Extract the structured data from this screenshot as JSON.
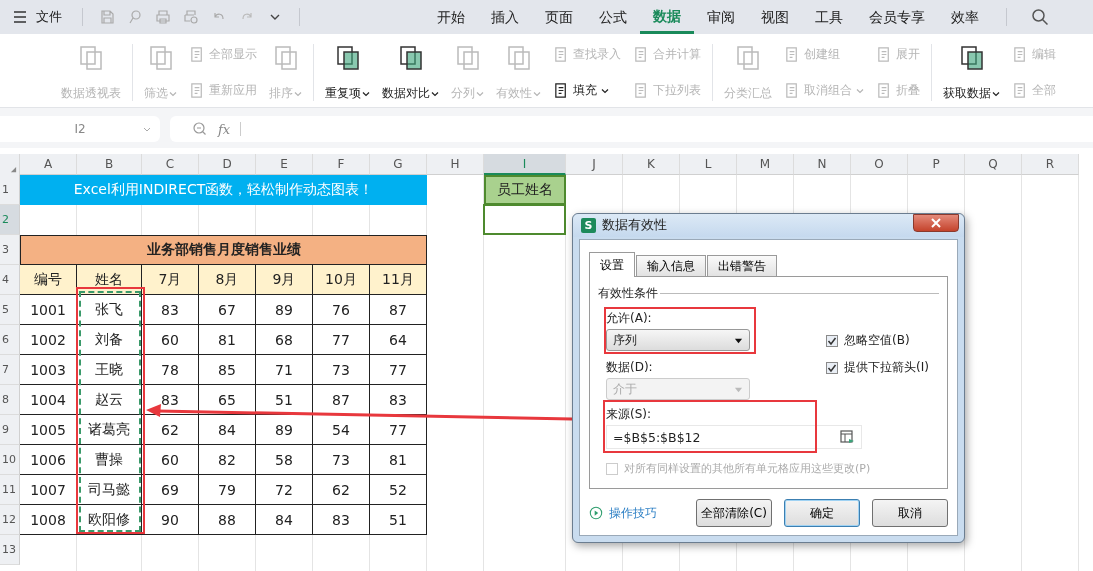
{
  "title_bar": {
    "file_menu": "文件",
    "tabs": [
      {
        "label": "开始",
        "selected": false
      },
      {
        "label": "插入",
        "selected": false
      },
      {
        "label": "页面",
        "selected": false
      },
      {
        "label": "公式",
        "selected": false
      },
      {
        "label": "数据",
        "selected": true
      },
      {
        "label": "审阅",
        "selected": false
      },
      {
        "label": "视图",
        "selected": false
      },
      {
        "label": "工具",
        "selected": false
      },
      {
        "label": "会员专享",
        "selected": false
      },
      {
        "label": "效率",
        "selected": false
      }
    ]
  },
  "ribbon": {
    "groups": [
      {
        "columns": [
          {
            "kind": "large",
            "label": "数据透视表",
            "disabled": true,
            "dropdown": false
          }
        ]
      },
      {
        "columns": [
          {
            "kind": "large",
            "label": "筛选",
            "disabled": true,
            "dropdown": true
          },
          {
            "kind": "stack",
            "items": [
              {
                "label": "全部显示",
                "disabled": true,
                "dropdown": false
              },
              {
                "label": "重新应用",
                "disabled": true,
                "dropdown": false
              }
            ]
          },
          {
            "kind": "large",
            "label": "排序",
            "disabled": true,
            "dropdown": true
          }
        ]
      },
      {
        "columns": [
          {
            "kind": "large",
            "label": "重复项",
            "disabled": false,
            "dropdown": true
          },
          {
            "kind": "large",
            "label": "数据对比",
            "disabled": false,
            "dropdown": true
          },
          {
            "kind": "large",
            "label": "分列",
            "disabled": true,
            "dropdown": true
          },
          {
            "kind": "large",
            "label": "有效性",
            "disabled": true,
            "dropdown": true
          },
          {
            "kind": "stack",
            "items": [
              {
                "label": "查找录入",
                "disabled": true,
                "dropdown": false
              },
              {
                "label": "填充",
                "disabled": false,
                "dropdown": true
              }
            ]
          },
          {
            "kind": "stack",
            "items": [
              {
                "label": "合并计算",
                "disabled": true,
                "dropdown": false
              },
              {
                "label": "下拉列表",
                "disabled": true,
                "dropdown": false
              }
            ]
          }
        ]
      },
      {
        "columns": [
          {
            "kind": "large",
            "label": "分类汇总",
            "disabled": true,
            "dropdown": false
          },
          {
            "kind": "stack",
            "items": [
              {
                "label": "创建组",
                "disabled": true,
                "dropdown": false
              },
              {
                "label": "取消组合",
                "disabled": true,
                "dropdown": true
              }
            ]
          },
          {
            "kind": "stack",
            "items": [
              {
                "label": "展开",
                "disabled": true,
                "dropdown": false
              },
              {
                "label": "折叠",
                "disabled": true,
                "dropdown": false
              }
            ]
          }
        ]
      },
      {
        "columns": [
          {
            "kind": "large",
            "label": "获取数据",
            "disabled": false,
            "dropdown": true
          },
          {
            "kind": "stack",
            "items": [
              {
                "label": "编辑",
                "disabled": true,
                "dropdown": false
              },
              {
                "label": "全部",
                "disabled": true,
                "dropdown": false
              }
            ]
          }
        ]
      }
    ]
  },
  "formula_bar": {
    "cell_reference": "I2",
    "function_label": "fx"
  },
  "sheet": {
    "columns": [
      {
        "label": "A",
        "selected": false
      },
      {
        "label": "B",
        "selected": false
      },
      {
        "label": "C",
        "selected": false
      },
      {
        "label": "D",
        "selected": false
      },
      {
        "label": "E",
        "selected": false
      },
      {
        "label": "F",
        "selected": false
      },
      {
        "label": "G",
        "selected": false
      },
      {
        "label": "H",
        "selected": false
      },
      {
        "label": "I",
        "selected": true
      },
      {
        "label": "J",
        "selected": false
      },
      {
        "label": "K",
        "selected": false
      },
      {
        "label": "L",
        "selected": false
      },
      {
        "label": "M",
        "selected": false
      },
      {
        "label": "N",
        "selected": false
      },
      {
        "label": "O",
        "selected": false
      },
      {
        "label": "P",
        "selected": false
      },
      {
        "label": "Q",
        "selected": false
      },
      {
        "label": "R",
        "selected": false
      }
    ],
    "row_numbers": [
      {
        "label": "1",
        "selected": false
      },
      {
        "label": "2",
        "selected": true
      },
      {
        "label": "3",
        "selected": false
      },
      {
        "label": "4",
        "selected": false
      },
      {
        "label": "5",
        "selected": false
      },
      {
        "label": "6",
        "selected": false
      },
      {
        "label": "7",
        "selected": false
      },
      {
        "label": "8",
        "selected": false
      },
      {
        "label": "9",
        "selected": false
      },
      {
        "label": "10",
        "selected": false
      },
      {
        "label": "11",
        "selected": false
      },
      {
        "label": "12",
        "selected": false
      },
      {
        "label": "13",
        "selected": false
      }
    ],
    "banner": "Excel利用INDIRECT函数，轻松制作动态图表！",
    "lookup_label": "员工姓名",
    "table": {
      "caption": "业务部销售月度销售业绩",
      "headers": [
        "编号",
        "姓名",
        "7月",
        "8月",
        "9月",
        "10月",
        "11月"
      ],
      "rows": [
        [
          "1001",
          "张飞",
          "83",
          "67",
          "89",
          "76",
          "87"
        ],
        [
          "1002",
          "刘备",
          "60",
          "81",
          "68",
          "77",
          "64"
        ],
        [
          "1003",
          "王晓",
          "78",
          "85",
          "71",
          "73",
          "77"
        ],
        [
          "1004",
          "赵云",
          "83",
          "65",
          "51",
          "87",
          "83"
        ],
        [
          "1005",
          "诸葛亮",
          "62",
          "84",
          "89",
          "54",
          "77"
        ],
        [
          "1006",
          "曹操",
          "60",
          "82",
          "58",
          "73",
          "81"
        ],
        [
          "1007",
          "司马懿",
          "69",
          "79",
          "72",
          "62",
          "52"
        ],
        [
          "1008",
          "欧阳修",
          "90",
          "88",
          "84",
          "83",
          "51"
        ]
      ]
    }
  },
  "dialog": {
    "app_badge": "S",
    "title": "数据有效性",
    "tabs": [
      {
        "label": "设置",
        "selected": true
      },
      {
        "label": "输入信息",
        "selected": false
      },
      {
        "label": "出错警告",
        "selected": false
      }
    ],
    "section": "有效性条件",
    "allow_label": "允许(A):",
    "allow_value": "序列",
    "data_label": "数据(D):",
    "data_value": "介于",
    "data_disabled": true,
    "checkboxes": [
      {
        "label": "忽略空值(B)",
        "checked": true
      },
      {
        "label": "提供下拉箭头(I)",
        "checked": true
      }
    ],
    "source_label": "来源(S):",
    "source_value": "=$B$5:$B$12",
    "apply_all": {
      "label": "对所有同样设置的其他所有单元格应用这些更改(P)",
      "checked": false,
      "disabled": true
    },
    "tips_link": "操作技巧",
    "buttons": [
      {
        "label": "全部清除(C)",
        "selected": false
      },
      {
        "label": "确定",
        "selected": true
      },
      {
        "label": "取消",
        "selected": false
      }
    ]
  }
}
